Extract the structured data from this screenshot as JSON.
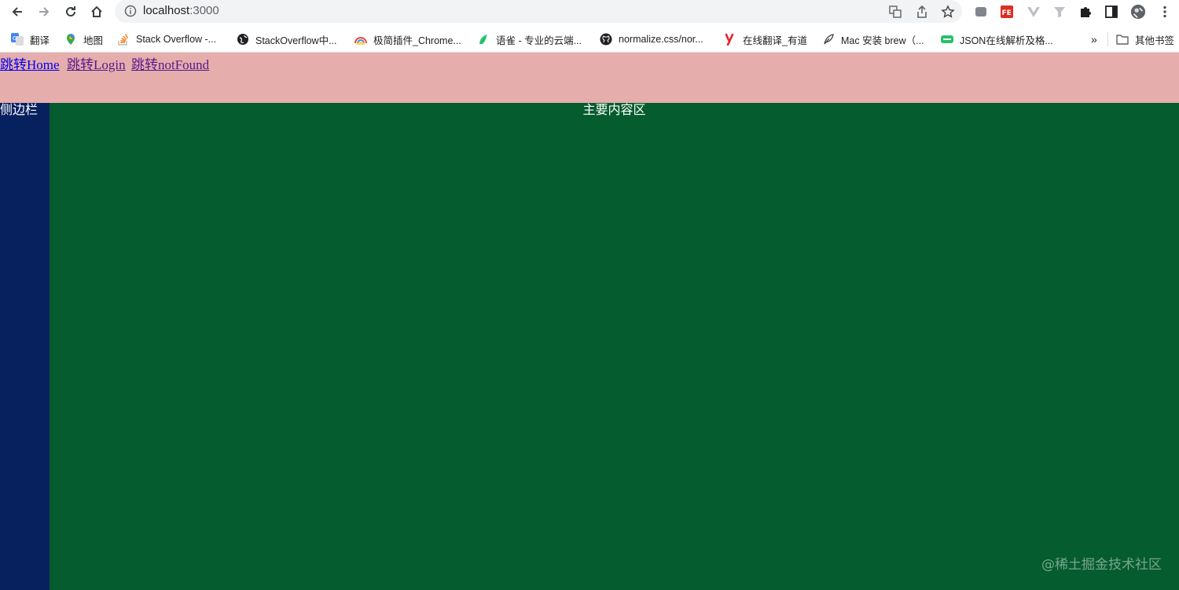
{
  "browser": {
    "url_host": "localhost",
    "url_port": ":3000",
    "bookmarks": [
      {
        "label": "翻译",
        "icon": "google-translate-icon"
      },
      {
        "label": "地图",
        "icon": "google-maps-icon"
      },
      {
        "label": "Stack Overflow -...",
        "icon": "stackoverflow-icon"
      },
      {
        "label": "StackOverflow中...",
        "icon": "globe-icon"
      },
      {
        "label": "极简插件_Chrome...",
        "icon": "rainbow-icon"
      },
      {
        "label": "语雀 - 专业的云端...",
        "icon": "yuque-icon"
      },
      {
        "label": "normalize.css/nor...",
        "icon": "github-icon"
      },
      {
        "label": "在线翻译_有道",
        "icon": "youdao-icon"
      },
      {
        "label": "Mac 安装 brew（...",
        "icon": "feather-icon"
      },
      {
        "label": "JSON在线解析及格...",
        "icon": "json-icon"
      }
    ],
    "more_label": "»",
    "other_bookmarks_label": "其他书签"
  },
  "page": {
    "links": [
      "跳转Home",
      "跳转Login",
      "跳转notFound"
    ],
    "sidebar_label": "侧边栏",
    "main_label": "主要内容区",
    "watermark": "@稀土掘金技术社区"
  },
  "colors": {
    "header_bg": "#e6adad",
    "sidebar_bg": "#07215f",
    "main_bg": "#055c2e",
    "link_unvisited": "#0000ee",
    "link_visited": "#551a8b"
  }
}
